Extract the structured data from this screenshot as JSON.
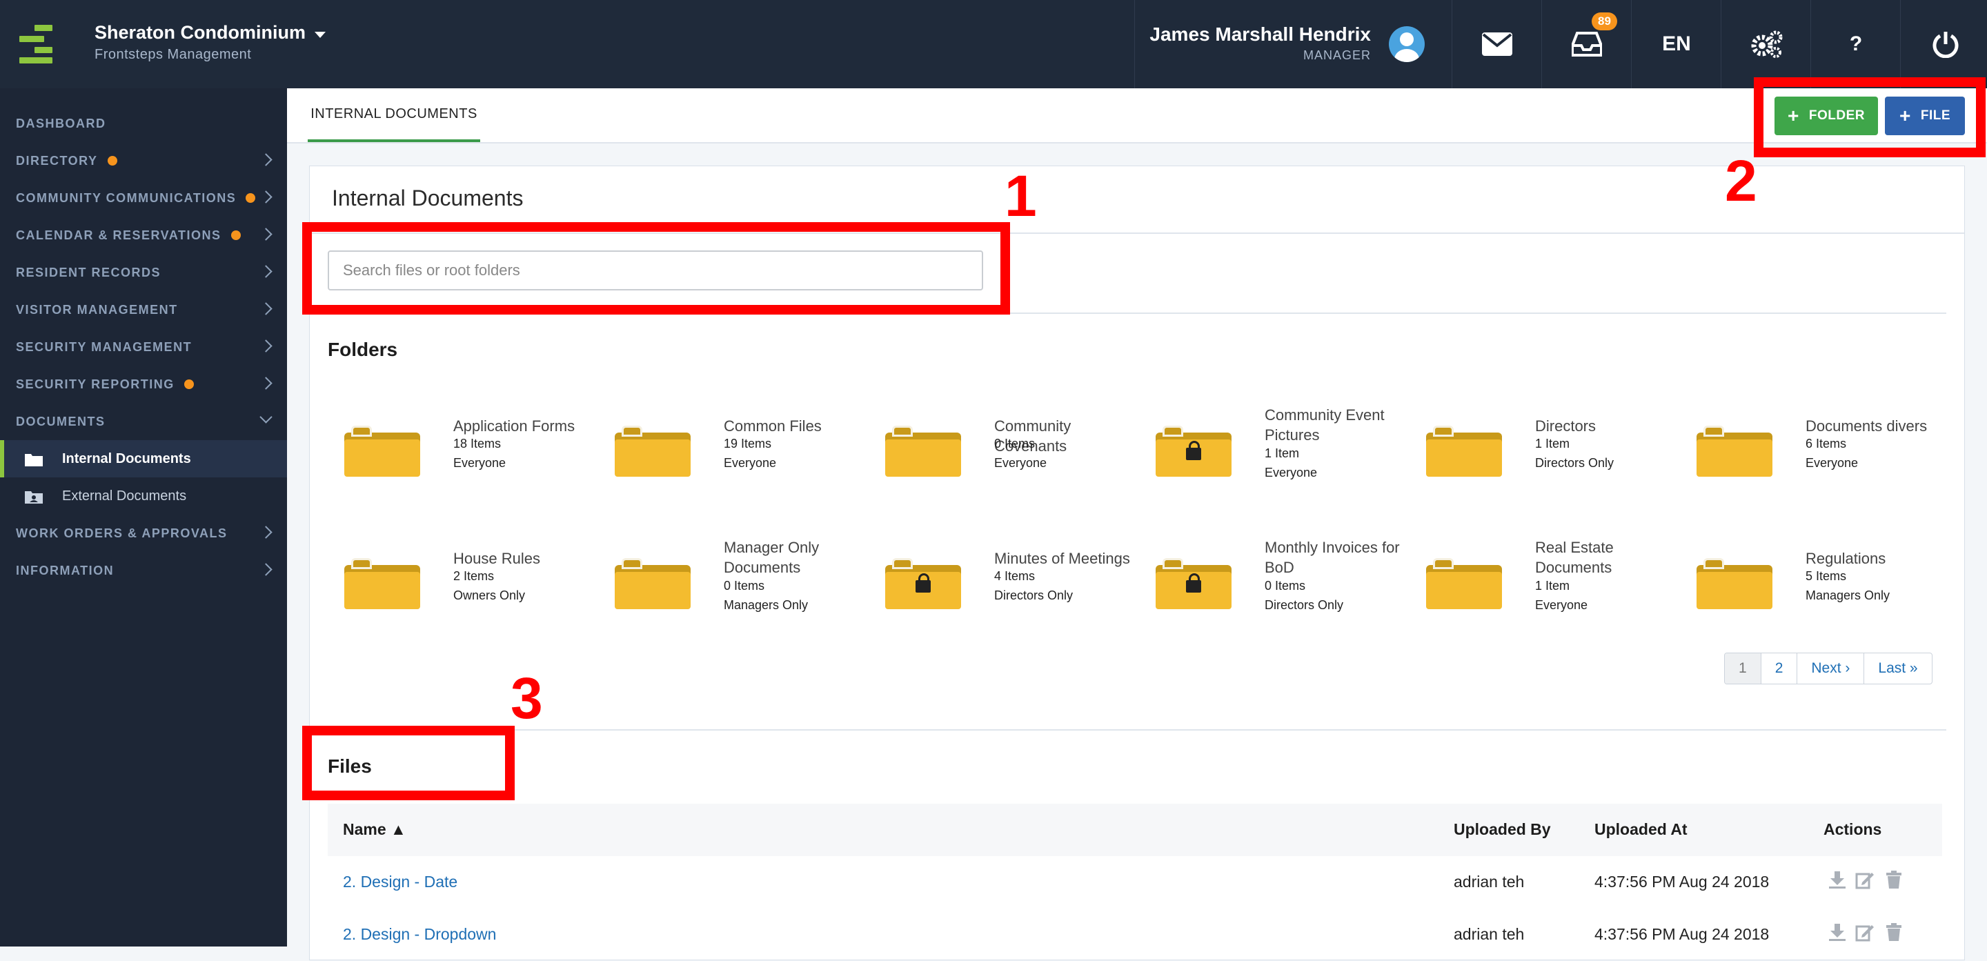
{
  "header": {
    "org_name": "Sheraton Condominium",
    "org_sub": "Frontsteps Management",
    "user_name": "James Marshall Hendrix",
    "user_role": "MANAGER",
    "inbox_badge": "89",
    "language": "EN",
    "help": "?"
  },
  "sidebar": {
    "items": [
      {
        "label": "DASHBOARD"
      },
      {
        "label": "DIRECTORY"
      },
      {
        "label": "COMMUNITY COMMUNICATIONS"
      },
      {
        "label": "CALENDAR & RESERVATIONS"
      },
      {
        "label": "RESIDENT RECORDS"
      },
      {
        "label": "VISITOR MANAGEMENT"
      },
      {
        "label": "SECURITY MANAGEMENT"
      },
      {
        "label": "SECURITY REPORTING"
      },
      {
        "label": "DOCUMENTS"
      },
      {
        "label": "WORK ORDERS & APPROVALS"
      },
      {
        "label": "INFORMATION"
      }
    ],
    "sub_items": [
      {
        "label": "Internal Documents"
      },
      {
        "label": "External Documents"
      }
    ]
  },
  "tabs": {
    "active": "INTERNAL DOCUMENTS"
  },
  "toolbar": {
    "folder_label": "FOLDER",
    "file_label": "FILE"
  },
  "panel": {
    "title": "Internal Documents",
    "search_placeholder": "Search files or root folders",
    "folders_heading": "Folders",
    "files_heading": "Files"
  },
  "folders": [
    {
      "name": "Application Forms",
      "count": "18 Items",
      "access": "Everyone",
      "locked": false
    },
    {
      "name": "Common Files",
      "count": "19 Items",
      "access": "Everyone",
      "locked": false
    },
    {
      "name": "Community Covenants",
      "count": "0 Items",
      "access": "Everyone",
      "locked": false
    },
    {
      "name": "Community Event Pictures",
      "count": "1 Item",
      "access": "Everyone",
      "locked": true
    },
    {
      "name": "Directors",
      "count": "1 Item",
      "access": "Directors Only",
      "locked": false
    },
    {
      "name": "Documents divers",
      "count": "6 Items",
      "access": "Everyone",
      "locked": false
    },
    {
      "name": "House Rules",
      "count": "2 Items",
      "access": "Owners Only",
      "locked": false
    },
    {
      "name": "Manager Only Documents",
      "count": "0 Items",
      "access": "Managers Only",
      "locked": false
    },
    {
      "name": "Minutes of Meetings",
      "count": "4 Items",
      "access": "Directors Only",
      "locked": true
    },
    {
      "name": "Monthly Invoices for BoD",
      "count": "0 Items",
      "access": "Directors Only",
      "locked": true
    },
    {
      "name": "Real Estate Documents",
      "count": "1 Item",
      "access": "Everyone",
      "locked": false
    },
    {
      "name": "Regulations",
      "count": "5 Items",
      "access": "Managers Only",
      "locked": false
    }
  ],
  "pagination": {
    "p1": "1",
    "p2": "2",
    "next": "Next ›",
    "last": "Last »"
  },
  "files_table": {
    "headers": {
      "name": "Name ▲",
      "uploaded_by": "Uploaded By",
      "uploaded_at": "Uploaded At",
      "actions": "Actions"
    },
    "rows": [
      {
        "name": "2. Design - Date",
        "uploaded_by": "adrian teh",
        "uploaded_at": "4:37:56 PM Aug 24 2018"
      },
      {
        "name": "2. Design - Dropdown",
        "uploaded_by": "adrian teh",
        "uploaded_at": "4:37:56 PM Aug 24 2018"
      }
    ]
  },
  "annotations": {
    "n1": "1",
    "n2": "2",
    "n3": "3"
  },
  "colors": {
    "annotation": "#ff0000",
    "folder_button": "#3fa64a",
    "file_button": "#2f62ad",
    "accent_dot": "#f7941d",
    "brand_green": "#8dc63f"
  }
}
